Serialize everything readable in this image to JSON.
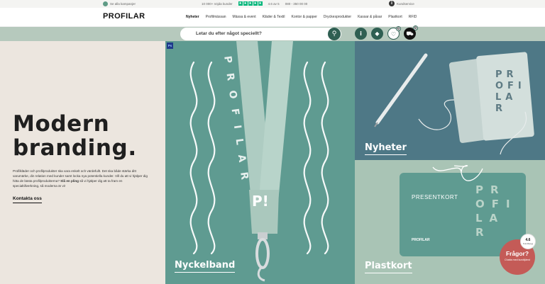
{
  "topbar": {
    "campaigns": "Se alla kampanjer",
    "customers": "10 000+ nöjda kunder",
    "rating": "4.6 av 5",
    "phone": "080 - 350 00 00",
    "service": "Kundservice"
  },
  "header": {
    "logo": "PROFILAR",
    "nav": [
      "Nyheter",
      "Profilmässan",
      "Mässa & event",
      "Kläder & Textil",
      "Kontor & papper",
      "Dryckesprodukter",
      "Kassar & påsar",
      "Plastkort",
      "RFID"
    ]
  },
  "search": {
    "placeholder": "Letar du efter något speciellt?",
    "cart_count": "0",
    "favorites_count": "0"
  },
  "hero": {
    "title_line1": "Modern",
    "title_line2": "branding.",
    "text_before": "Profilkläder och profilprodukter ska vara enkelt och värdefullt. Det ska både stärka ditt varumärke, din relation med kunder samt locka nya potentiella kunder. Vill du att vi hjälper dig hitta de bästa profilprodukterna? ",
    "text_bold": "Slå en pling",
    "text_after": " så vi hjälper dig att ta fram en specialtillverkning, så moderna är vi!",
    "link": "Kontakta oss"
  },
  "tiles": {
    "lanyard_label": "Nyckelband",
    "lanyard_print": "P!",
    "news_label": "Nyheter",
    "plastkort_label": "Plastkort",
    "card_title": "PRESENTKORT",
    "card_logo": "PROFILAR",
    "card_letters": "PROFILAR",
    "notebook_letters": "PROFILAR"
  },
  "widgets": {
    "help_title": "Frågor?",
    "help_subtitle": "Chatta med kundtjänst",
    "rating_value": "4.6",
    "rating_sub": "Kundbetyg"
  },
  "colors": {
    "accent": "#2f5f52",
    "lanyard_bg": "#5f9b91",
    "news_bg": "#4e7886",
    "plast_bg": "#a9c4b5",
    "hero_bg": "#ece6df",
    "help_bg": "#c45b57"
  }
}
